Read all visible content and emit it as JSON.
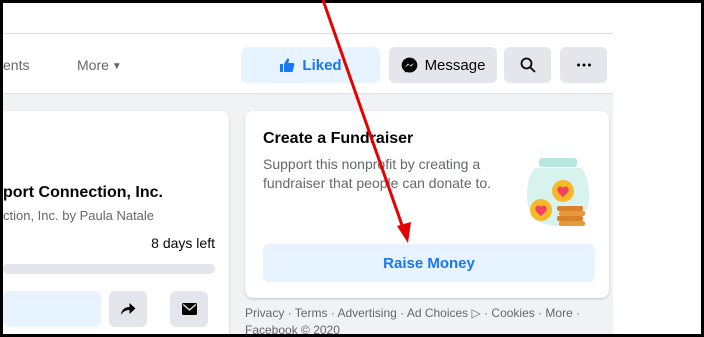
{
  "nav": {
    "events_tab": "ents",
    "more_tab": "More",
    "liked_label": "Liked",
    "message_label": "Message"
  },
  "left_card": {
    "title": "port Connection, Inc.",
    "subtitle": "ction, Inc. by Paula Natale",
    "days_left": "8 days left",
    "progress_fraction": 0.0
  },
  "fundraiser_card": {
    "title": "Create a Fundraiser",
    "description": "Support this nonprofit by creating a fundraiser that people can donate to.",
    "raise_label": "Raise Money"
  },
  "footer": {
    "links": "Privacy · Terms · Advertising · Ad Choices ▷ · Cookies · More ·",
    "copyright": "Facebook © 2020"
  },
  "icons": {
    "liked": "thumbs-up-icon",
    "message": "messenger-icon",
    "search": "search-icon",
    "more": "ellipsis-icon",
    "share": "share-arrow-icon",
    "mail": "envelope-icon",
    "jar": "donation-jar-icon"
  },
  "colors": {
    "accent": "#1877f2",
    "accent_bg": "#e7f3ff",
    "annotation_arrow": "#e60000"
  }
}
